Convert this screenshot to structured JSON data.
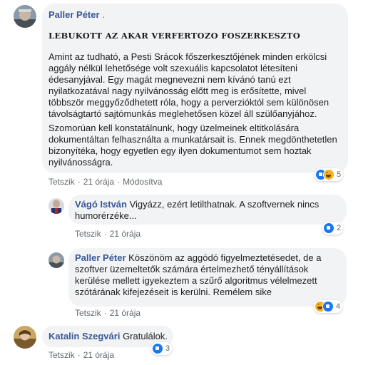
{
  "comments": [
    {
      "author": "Paller Péter",
      "suffix": ".",
      "title": "LEBUKOTT AZ AKAR VERFERTOZO FOSZERKESZTO",
      "paragraphs": [
        "Amint az tudható, a Pesti Srácok főszerkesztőjének minden erkölcsi aggály nélkül lehetősége volt szexuális kapcsolatot létesíteni édesanyjával. Egy magát megnevezni nem kívánó tanú ezt nyilatkozatával nagy nyilvánosság előtt meg is erősítette, mivel többször meggyőződhetett róla, hogy a perverzióktól sem különösen távolságtartó sajtómunkás meglehetősen közel áll szülőanyjához.",
        "Szomorúan kell konstatálnunk, hogy üzelmeinek eltitkolására dokumentáltan felhasználta a munkatársait is. Ennek megdönthetetlen bizonyítéka, hogy egyetlen egy ilyen dokumentumot sem hoztak nyilvánosságra."
      ],
      "actions": {
        "like": "Tetszik",
        "time": "21 órája",
        "edited": "Módosítva"
      },
      "reaction_count": "5"
    },
    {
      "author": "Vágó István",
      "text": "Vigyázz, ezért letilthatnak. A szoftvernek nincs humorérzéke...",
      "actions": {
        "like": "Tetszik",
        "time": "21 órája"
      },
      "reaction_count": "2"
    },
    {
      "author": "Paller Péter",
      "text": "Köszönöm az aggódó figyelmeztetésedet, de a szoftver üzemeltetők számára értelmezhető tényállítások kerülése mellett igyekeztem a szűrő algoritmus vélelmezett szótárának kifejezéseit is kerülni. Remélem sike",
      "actions": {
        "like": "Tetszik",
        "time": "21 órája"
      },
      "reaction_count": "4"
    },
    {
      "author": "Katalin Szegvári",
      "text": "Gratulálok.",
      "actions": {
        "like": "Tetszik",
        "time": "21 órája"
      },
      "reaction_count": "3"
    }
  ],
  "colors": {
    "link": "#385898",
    "bubble": "#f2f3f5",
    "like": "#1877f2",
    "haha": "#f7b125"
  },
  "icons": [
    "like-icon",
    "haha-icon"
  ]
}
